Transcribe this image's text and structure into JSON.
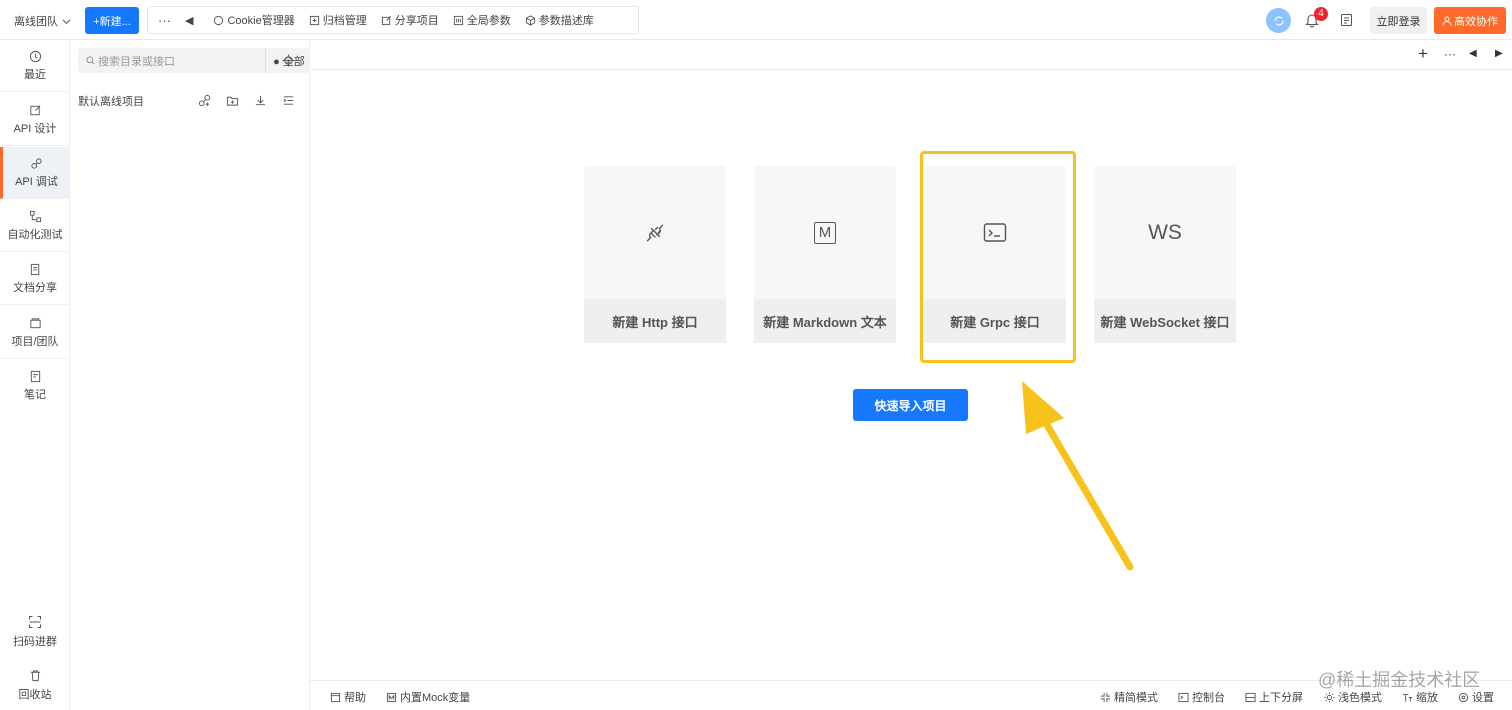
{
  "header": {
    "team_name": "离线团队",
    "new_button": "+新建...",
    "toolbar": {
      "more": "···",
      "back": "◀",
      "cookie": "Cookie管理器",
      "archive": "归档管理",
      "share_project": "分享项目",
      "global_params": "全局参数",
      "param_library": "参数描述库"
    },
    "notification_count": "4",
    "login": "立即登录",
    "collab": "高效协作"
  },
  "sidebar": {
    "items": [
      {
        "label": "最近",
        "icon": "clock-icon"
      },
      {
        "label": "API 设计",
        "icon": "edit-icon"
      },
      {
        "label": "API 调试",
        "icon": "link-icon"
      },
      {
        "label": "自动化测试",
        "icon": "flow-icon"
      },
      {
        "label": "文档分享",
        "icon": "doc-icon"
      },
      {
        "label": "项目/团队",
        "icon": "folder-icon"
      },
      {
        "label": "笔记",
        "icon": "note-icon"
      }
    ],
    "bottom": {
      "scan": "扫码进群",
      "trash": "回收站"
    }
  },
  "tree": {
    "search_placeholder": "搜索目录或接口",
    "filter": "全部",
    "project_title": "默认离线项目"
  },
  "main": {
    "tab_controls": {
      "add": "+",
      "more": "···",
      "prev": "◀",
      "next": "▶"
    },
    "cards": [
      {
        "label": "新建 Http 接口",
        "icon": "plug-icon"
      },
      {
        "label": "新建 Markdown 文本",
        "icon": "markdown-icon",
        "glyph": "M"
      },
      {
        "label": "新建 Grpc 接口",
        "icon": "terminal-icon"
      },
      {
        "label": "新建 WebSocket 接口",
        "icon": "websocket-icon",
        "glyph": "WS"
      }
    ],
    "import_button": "快速导入项目"
  },
  "statusbar": {
    "help": "帮助",
    "mock": "内置Mock变量",
    "simple_mode": "精简模式",
    "console": "控制台",
    "split": "上下分屏",
    "light_mode": "浅色模式",
    "zoom": "缩放",
    "settings": "设置"
  },
  "watermark": "@稀土掘金技术社区",
  "colors": {
    "primary": "#1677ff",
    "accent": "#ff6a2b",
    "highlight": "#f8c21c",
    "badge": "#f5222d"
  }
}
